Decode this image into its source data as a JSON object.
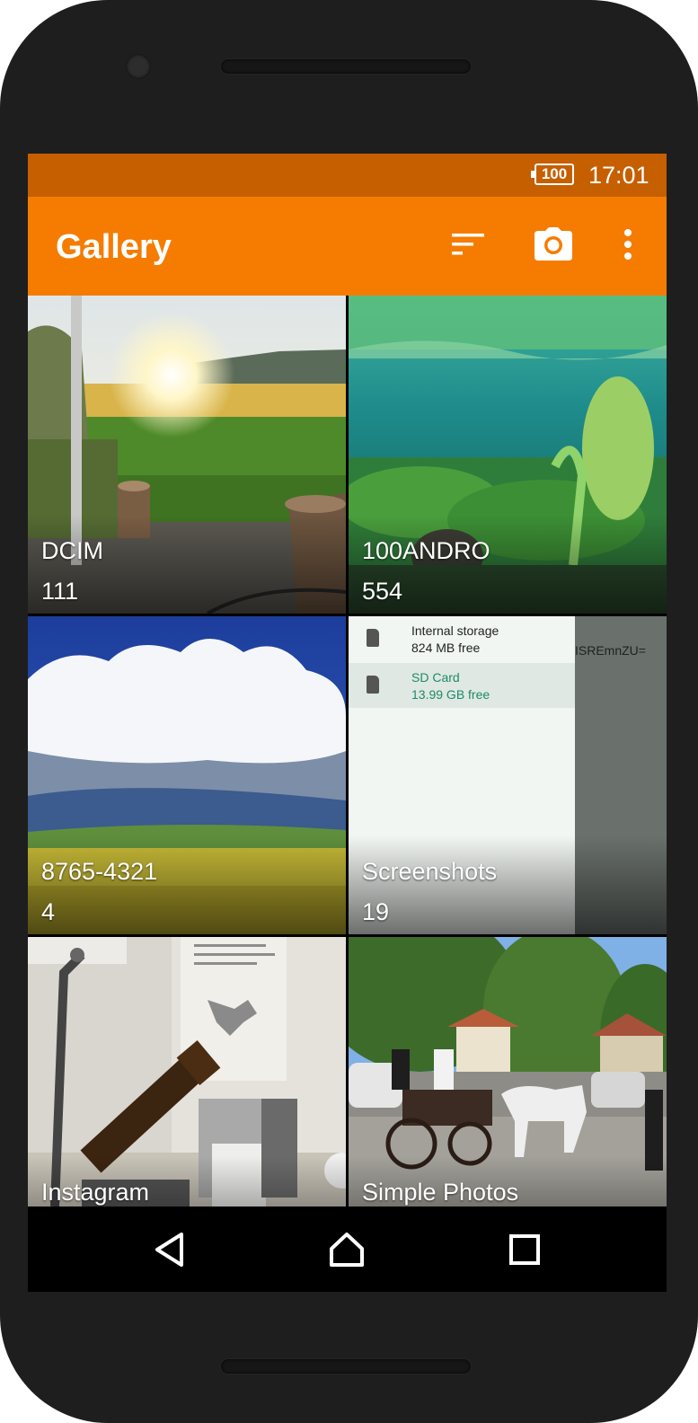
{
  "status_bar": {
    "battery": "100",
    "time": "17:01"
  },
  "toolbar": {
    "title": "Gallery",
    "sort_icon": "sort-icon",
    "camera_icon": "camera-icon",
    "more_icon": "more-vert-icon"
  },
  "colors": {
    "status_bar": "#c65f00",
    "toolbar": "#f57c00"
  },
  "albums": [
    {
      "name": "DCIM",
      "count": "111"
    },
    {
      "name": "100ANDRO",
      "count": "554"
    },
    {
      "name": "8765-4321",
      "count": "4"
    },
    {
      "name": "Screenshots",
      "count": "19"
    },
    {
      "name": "Instagram",
      "count": ""
    },
    {
      "name": "Simple Photos",
      "count": ""
    }
  ],
  "screenshot_thumb": {
    "internal_title": "Internal storage",
    "internal_free": "824 MB free",
    "sd_title": "SD Card",
    "sd_free": "13.99 GB free",
    "code_fragment": "ISREmnZU="
  },
  "nav_bar": {
    "back_icon": "back-icon",
    "home_icon": "home-icon",
    "recents_icon": "recents-icon"
  }
}
